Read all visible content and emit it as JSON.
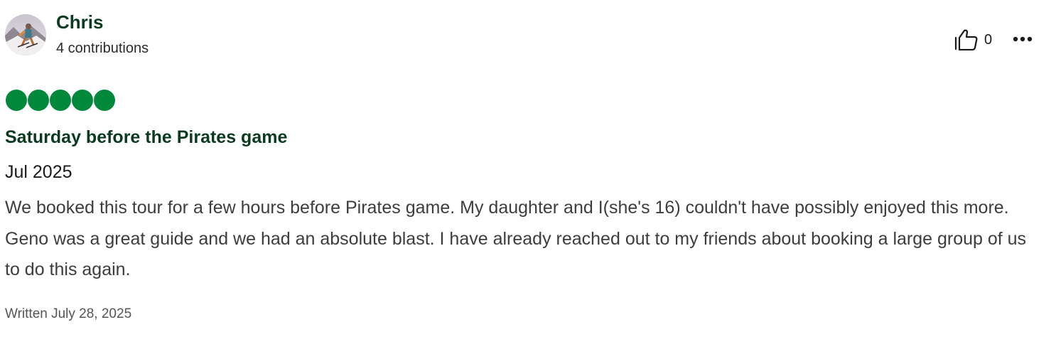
{
  "author": {
    "name": "Chris",
    "contributions": "4 contributions",
    "avatar_icon": "avatar-skier-photo"
  },
  "actions": {
    "helpful_icon": "thumbs-up-icon",
    "helpful_count": "0",
    "more_icon": "more-options-icon"
  },
  "rating": {
    "value": 5,
    "max": 5,
    "color": "#00893b"
  },
  "review": {
    "title": "Saturday before the Pirates game",
    "visit_date": "Jul 2025",
    "body": "We booked this tour for a few hours before Pirates game. My daughter and I(she's 16) couldn't have possibly enjoyed this more. Geno was a great guide and we had an absolute blast. I have already reached out to my friends about booking a large group of us to do this again.",
    "written": "Written July 28, 2025"
  },
  "colors": {
    "title_green": "#0b3b1e",
    "bubble_green": "#00893b"
  }
}
